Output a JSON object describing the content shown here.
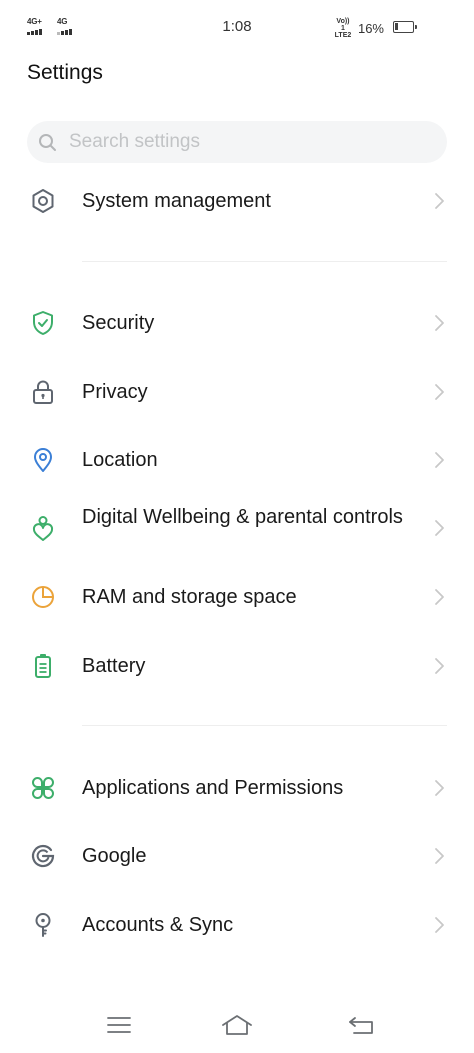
{
  "status_bar": {
    "sim1_label": "4G+",
    "sim2_label": "4G",
    "time": "1:08",
    "volte_line1": "Vo)) 1",
    "volte_line2": "LTE2",
    "battery_percent": "16%",
    "battery_level": 0.16
  },
  "page": {
    "title": "Settings"
  },
  "search": {
    "placeholder": "Search settings",
    "value": ""
  },
  "items": [
    {
      "label": "System management",
      "icon": "gear-hexagon-icon",
      "color": "#5f6670"
    },
    {
      "label": "Security",
      "icon": "shield-check-icon",
      "color": "#3dae6a"
    },
    {
      "label": "Privacy",
      "icon": "lock-icon",
      "color": "#5f6670"
    },
    {
      "label": "Location",
      "icon": "location-pin-icon",
      "color": "#3b7fd6"
    },
    {
      "label": "Digital Wellbeing & parental controls",
      "icon": "wellbeing-heart-icon",
      "color": "#3dae6a"
    },
    {
      "label": "RAM and storage space",
      "icon": "storage-pie-icon",
      "color": "#eba33a"
    },
    {
      "label": "Battery",
      "icon": "battery-icon",
      "color": "#3dae6a"
    },
    {
      "label": "Applications and Permissions",
      "icon": "apps-grid-icon",
      "color": "#3dae6a"
    },
    {
      "label": "Google",
      "icon": "google-icon",
      "color": "#5f6670"
    },
    {
      "label": "Accounts & Sync",
      "icon": "key-icon",
      "color": "#5f6670"
    }
  ],
  "nav": {
    "menu": "menu-icon",
    "home": "home-icon",
    "back": "back-icon"
  }
}
